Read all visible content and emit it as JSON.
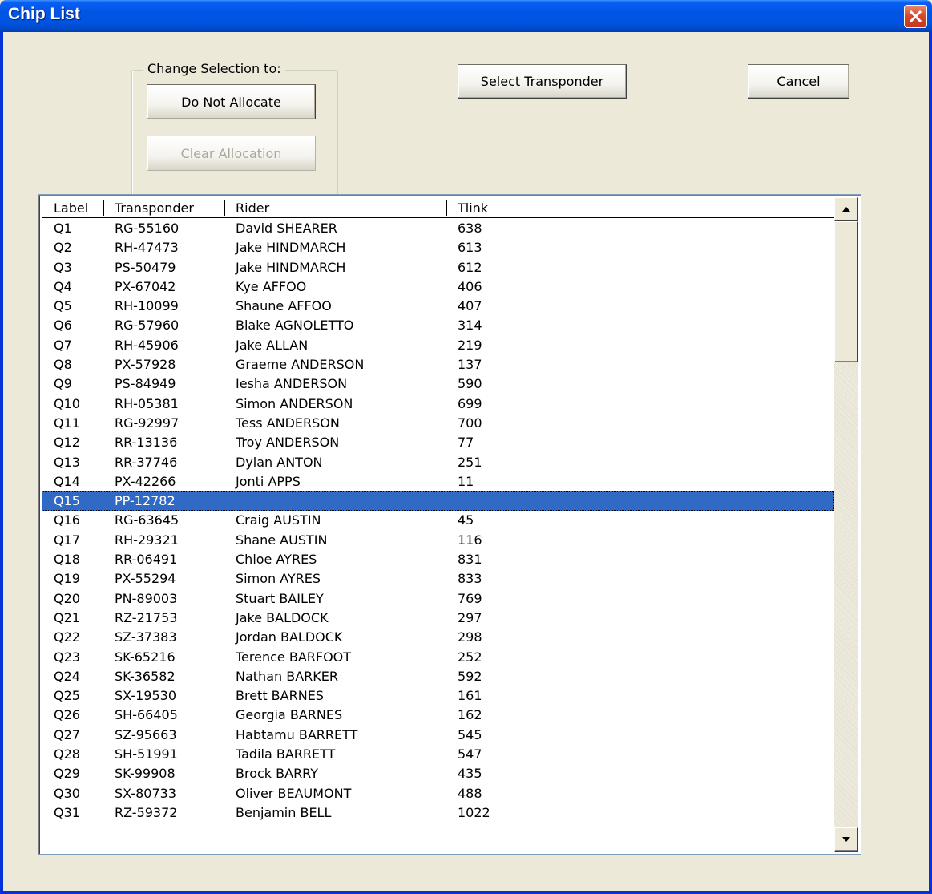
{
  "window": {
    "title": "Chip List"
  },
  "group": {
    "legend": "Change Selection to:"
  },
  "buttons": {
    "do_not_allocate": "Do Not Allocate",
    "clear_allocation": "Clear Allocation",
    "select_transponder": "Select Transponder",
    "cancel": "Cancel"
  },
  "list": {
    "columns": [
      "Label",
      "Transponder",
      "Rider",
      "Tlink"
    ],
    "selected_index": 14,
    "rows": [
      [
        "Q1",
        "RG-55160",
        "David SHEARER",
        "638"
      ],
      [
        "Q2",
        "RH-47473",
        "Jake HINDMARCH",
        "613"
      ],
      [
        "Q3",
        "PS-50479",
        "Jake HINDMARCH",
        "612"
      ],
      [
        "Q4",
        "PX-67042",
        "Kye AFFOO",
        "406"
      ],
      [
        "Q5",
        "RH-10099",
        "Shaune AFFOO",
        "407"
      ],
      [
        "Q6",
        "RG-57960",
        "Blake AGNOLETTO",
        "314"
      ],
      [
        "Q7",
        "RH-45906",
        "Jake ALLAN",
        "219"
      ],
      [
        "Q8",
        "PX-57928",
        "Graeme ANDERSON",
        "137"
      ],
      [
        "Q9",
        "PS-84949",
        "Iesha ANDERSON",
        "590"
      ],
      [
        "Q10",
        "RH-05381",
        "Simon ANDERSON",
        "699"
      ],
      [
        "Q11",
        "RG-92997",
        "Tess ANDERSON",
        "700"
      ],
      [
        "Q12",
        "RR-13136",
        "Troy ANDERSON",
        "77"
      ],
      [
        "Q13",
        "RR-37746",
        "Dylan ANTON",
        "251"
      ],
      [
        "Q14",
        "PX-42266",
        "Jonti APPS",
        "11"
      ],
      [
        "Q15",
        "PP-12782",
        "",
        ""
      ],
      [
        "Q16",
        "RG-63645",
        "Craig AUSTIN",
        "45"
      ],
      [
        "Q17",
        "RH-29321",
        "Shane AUSTIN",
        "116"
      ],
      [
        "Q18",
        "RR-06491",
        "Chloe AYRES",
        "831"
      ],
      [
        "Q19",
        "PX-55294",
        "Simon AYRES",
        "833"
      ],
      [
        "Q20",
        "PN-89003",
        "Stuart BAILEY",
        "769"
      ],
      [
        "Q21",
        "RZ-21753",
        "Jake BALDOCK",
        "297"
      ],
      [
        "Q22",
        "SZ-37383",
        "Jordan BALDOCK",
        "298"
      ],
      [
        "Q23",
        "SK-65216",
        "Terence BARFOOT",
        "252"
      ],
      [
        "Q24",
        "SK-36582",
        "Nathan BARKER",
        "592"
      ],
      [
        "Q25",
        "SX-19530",
        "Brett BARNES",
        "161"
      ],
      [
        "Q26",
        "SH-66405",
        "Georgia BARNES",
        "162"
      ],
      [
        "Q27",
        "SZ-95663",
        "Habtamu BARRETT",
        "545"
      ],
      [
        "Q28",
        "SH-51991",
        "Tadila BARRETT",
        "547"
      ],
      [
        "Q29",
        "SK-99908",
        "Brock BARRY",
        "435"
      ],
      [
        "Q30",
        "SX-80733",
        "Oliver BEAUMONT",
        "488"
      ],
      [
        "Q31",
        "RZ-59372",
        "Benjamin BELL",
        "1022"
      ]
    ]
  },
  "colors": {
    "title_bar": "#0054e3",
    "selection": "#316ac5",
    "close_button": "#d6462a"
  }
}
